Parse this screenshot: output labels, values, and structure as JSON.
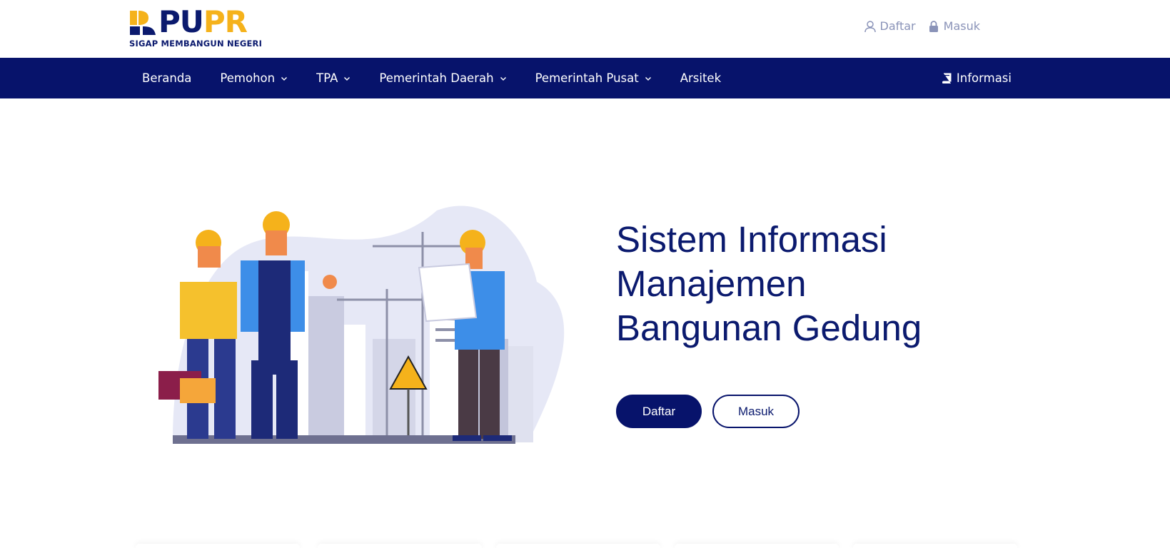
{
  "brand": {
    "logo_pu": "PU",
    "logo_pr": "PR",
    "tagline": "SIGAP MEMBANGUN NEGERI",
    "colors": {
      "navy": "#07136b",
      "yellow": "#f5b21b"
    }
  },
  "top_links": {
    "register_label": "Daftar",
    "register_icon": "user-icon",
    "login_label": "Masuk",
    "login_icon": "lock-icon"
  },
  "nav": {
    "items": [
      {
        "label": "Beranda",
        "dropdown": false
      },
      {
        "label": "Pemohon",
        "dropdown": true
      },
      {
        "label": "TPA",
        "dropdown": true
      },
      {
        "label": "Pemerintah Daerah",
        "dropdown": true
      },
      {
        "label": "Pemerintah Pusat",
        "dropdown": true
      },
      {
        "label": "Arsitek",
        "dropdown": false
      }
    ],
    "info_label": "Informasi",
    "info_icon": "book-icon"
  },
  "hero": {
    "title_line1": "Sistem Informasi",
    "title_line2": "Manajemen",
    "title_line3": "Bangunan Gedung",
    "primary_button": "Daftar",
    "secondary_button": "Masuk"
  }
}
